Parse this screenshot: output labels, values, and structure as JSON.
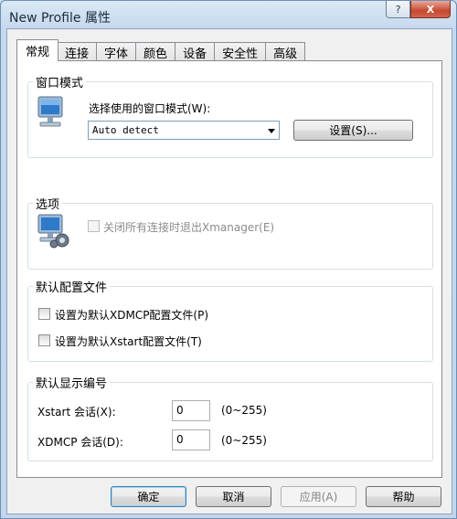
{
  "window": {
    "title": "New Profile 属性",
    "help_glyph": "?",
    "close_glyph": "X"
  },
  "tabs": [
    {
      "label": "常规",
      "active": true
    },
    {
      "label": "连接"
    },
    {
      "label": "字体"
    },
    {
      "label": "颜色"
    },
    {
      "label": "设备"
    },
    {
      "label": "安全性"
    },
    {
      "label": "高级"
    }
  ],
  "window_mode": {
    "title": "窗口模式",
    "prompt": "选择使用的窗口模式(W):",
    "selected": "Auto detect",
    "settings_button": "设置(S)..."
  },
  "options": {
    "title": "选项",
    "close_exit_label": "关闭所有连接时退出Xmanager(E)",
    "close_exit_checked": false,
    "close_exit_enabled": false
  },
  "default_config": {
    "title": "默认配置文件",
    "xdmcp_label": "设置为默认XDMCP配置文件(P)",
    "xdmcp_checked": false,
    "xstart_label": "设置为默认Xstart配置文件(T)",
    "xstart_checked": false
  },
  "display_number": {
    "title": "默认显示编号",
    "xstart_label": "Xstart 会话(X):",
    "xstart_value": "0",
    "xstart_range": "(0~255)",
    "xdmcp_label": "XDMCP 会话(D):",
    "xdmcp_value": "0",
    "xdmcp_range": "(0~255)"
  },
  "footer": {
    "ok": "确定",
    "cancel": "取消",
    "apply": "应用(A)",
    "help": "帮助"
  }
}
